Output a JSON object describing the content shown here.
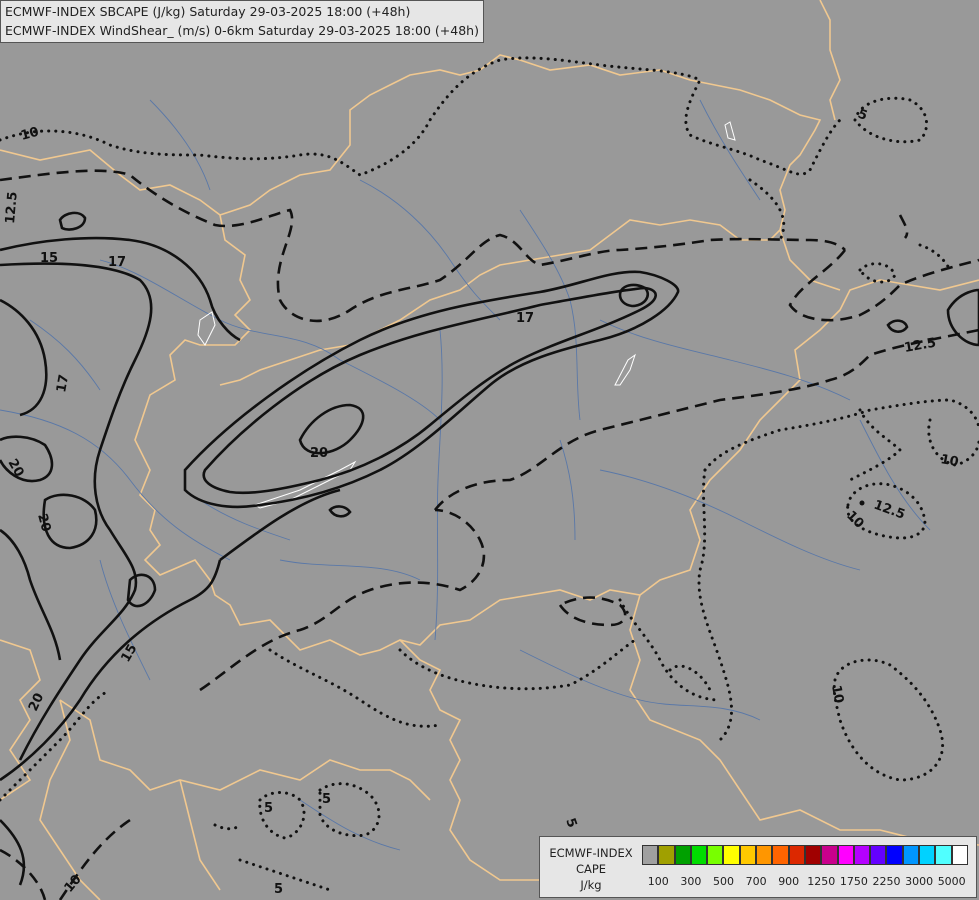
{
  "header": {
    "line1": "ECMWF-INDEX SBCAPE (J/kg) Saturday 29-03-2025 18:00 (+48h)",
    "line2": "ECMWF-INDEX WindShear_ (m/s) 0-6km Saturday 29-03-2025 18:00 (+48h)"
  },
  "colors": {
    "background": "#999999",
    "borders": "#f0c890",
    "rivers": "#5a78a8",
    "contours": "#111111"
  },
  "contour_labels": {
    "a": "10",
    "b": "12.5",
    "c": "15",
    "d": "17",
    "e": "17",
    "f": "20",
    "g": "17",
    "h": "20",
    "i": "20",
    "j": "15",
    "k": "20",
    "l": "12.5",
    "m": "10",
    "n": "12.5",
    "o": "10",
    "p": "5",
    "q": "10",
    "r": "5",
    "s": "5",
    "t": "5",
    "u": "10",
    "v": "5"
  },
  "legend": {
    "title_lines": [
      "ECMWF-INDEX",
      "CAPE",
      "J/kg"
    ],
    "colors": [
      "#a0a0a0",
      "#a0a000",
      "#00a000",
      "#00dc00",
      "#78ff00",
      "#ffff00",
      "#ffc800",
      "#ff9600",
      "#ff6400",
      "#dc2800",
      "#a00000",
      "#c8008c",
      "#ff00ff",
      "#b400ff",
      "#6400ff",
      "#0000ff",
      "#0096ff",
      "#00d2ff",
      "#50ffff",
      "#ffffff"
    ],
    "tick_labels": [
      "100",
      "300",
      "500",
      "700",
      "900",
      "1250",
      "1750",
      "2250",
      "3000",
      "5000"
    ]
  }
}
